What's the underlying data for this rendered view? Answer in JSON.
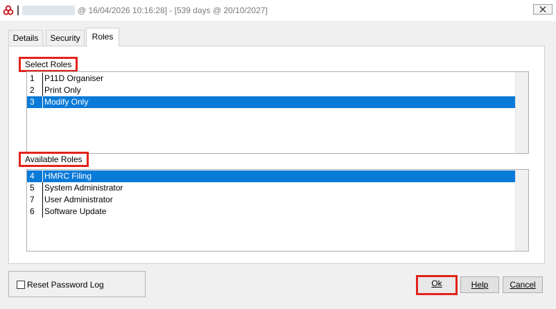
{
  "window": {
    "title": "@ 16/04/2026 10:16:28] - [539 days @ 20/10/2027]",
    "close_icon": "close-icon",
    "app_icon": "app-logo-icon"
  },
  "tabs": [
    {
      "label": "Details"
    },
    {
      "label": "Security"
    },
    {
      "label": "Roles",
      "active": true
    }
  ],
  "select_roles": {
    "label": "Select Roles",
    "items": [
      {
        "num": "1",
        "name": "P11D Organiser",
        "selected": false
      },
      {
        "num": "2",
        "name": "Print Only",
        "selected": false
      },
      {
        "num": "3",
        "name": "Modify Only",
        "selected": true
      }
    ]
  },
  "available_roles": {
    "label": "Available Roles",
    "items": [
      {
        "num": "4",
        "name": "HMRC Filing",
        "selected": true
      },
      {
        "num": "5",
        "name": "System Administrator",
        "selected": false
      },
      {
        "num": "7",
        "name": "User Administrator",
        "selected": false
      },
      {
        "num": "6",
        "name": "Software Update",
        "selected": false
      }
    ]
  },
  "footer": {
    "reset_password_log": "Reset Password Log",
    "reset_checked": false,
    "ok": "Ok",
    "help": "Help",
    "cancel": "Cancel"
  },
  "colors": {
    "selection": "#0a7ad8",
    "highlight_box": "#e2231a"
  }
}
